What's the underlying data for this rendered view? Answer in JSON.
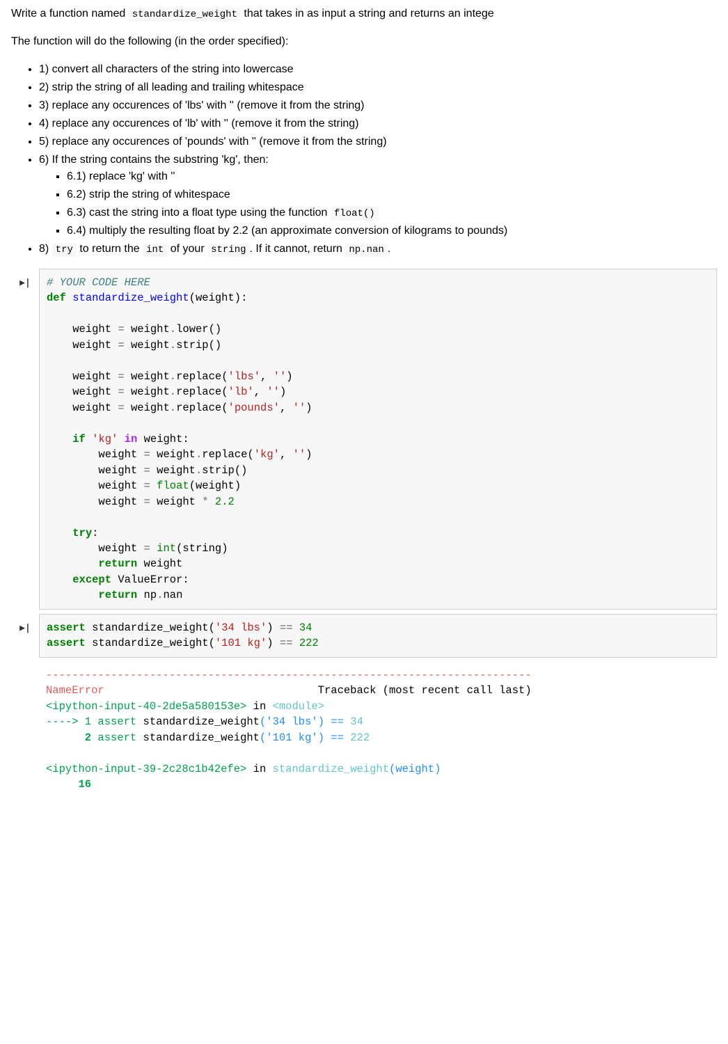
{
  "markdown": {
    "intro_prefix": "Write a function named ",
    "intro_codename": "standardize_weight",
    "intro_suffix": " that takes in as input a string and returns an intege",
    "lead": "The function will do the following (in the order specified):",
    "steps": [
      "1) convert all characters of the string into lowercase",
      "2) strip the string of all leading and trailing whitespace",
      "3) replace any occurences of 'lbs' with '' (remove it from the string)",
      "4) replace any occurences of 'lb' with '' (remove it from the string)",
      "5) replace any occurences of 'pounds' with '' (remove it from the string)",
      "6) If the string contains the substring 'kg', then:"
    ],
    "substeps": [
      "6.1) replace 'kg' with ''",
      "6.2) strip the string of whitespace"
    ],
    "substep63_prefix": "6.3) cast the string into a float type using the function ",
    "substep63_code": "float()",
    "substep64": "6.4) multiply the resulting float by 2.2 (an approximate conversion of kilograms to pounds)",
    "step8_1": "8) ",
    "step8_try": "try",
    "step8_2": " to return the ",
    "step8_int": "int",
    "step8_3": " of your ",
    "step8_string": "string",
    "step8_4": ". If it cannot, return ",
    "step8_npnan": "np.nan",
    "step8_5": "."
  },
  "cell1": {
    "comment": "# YOUR CODE HERE",
    "def_kw": "def",
    "funcname": "standardize_weight",
    "param": "weight",
    "var": "weight",
    "lower": "lower",
    "strip": "strip",
    "replace": "replace",
    "s_lbs": "'lbs'",
    "s_lb": "'lb'",
    "s_pounds": "'pounds'",
    "s_kg": "'kg'",
    "s_empty": "''",
    "if_kw": "if",
    "in_kw": "in",
    "float_fn": "float",
    "num22": "2.2",
    "try_kw": "try",
    "int_fn": "int",
    "string_var": "string",
    "return_kw": "return",
    "except_kw": "except",
    "valueerror": "ValueError",
    "np": "np",
    "nan": "nan"
  },
  "cell2": {
    "assert_kw": "assert",
    "funcname": "standardize_weight",
    "arg1": "'34 lbs'",
    "arg2": "'101 kg'",
    "eq": "==",
    "val1": "34",
    "val2": "222"
  },
  "output": {
    "dashline": "---------------------------------------------------------------------------",
    "errname": "NameError",
    "traceback_label": "Traceback (most recent call last)",
    "frame1_loc": "<ipython-input-40-2de5a580153e>",
    "in_module": " in ",
    "module_label": "<module>",
    "arrow": "----> 1 ",
    "line1_code_pre": "assert",
    "line1_fn": "standardize_weight",
    "line1_arg": "'34 lbs'",
    "line1_eq": "==",
    "line1_val": "34",
    "line2_prefix": "      2 ",
    "line2_arg": "'101 kg'",
    "line2_val": "222",
    "frame2_loc": "<ipython-input-39-2c28c1b42efe>",
    "frame2_fn_pre": " in ",
    "frame2_fn": "standardize_weight",
    "frame2_fn_arg": "(weight)",
    "lineno16": "     16"
  }
}
